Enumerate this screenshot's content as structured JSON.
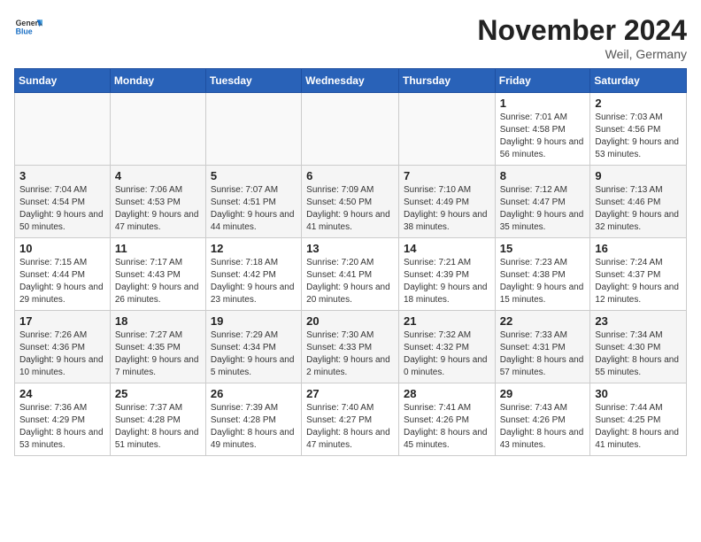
{
  "header": {
    "logo_line1": "General",
    "logo_line2": "Blue",
    "month_title": "November 2024",
    "location": "Weil, Germany"
  },
  "weekdays": [
    "Sunday",
    "Monday",
    "Tuesday",
    "Wednesday",
    "Thursday",
    "Friday",
    "Saturday"
  ],
  "weeks": [
    [
      {
        "day": "",
        "info": ""
      },
      {
        "day": "",
        "info": ""
      },
      {
        "day": "",
        "info": ""
      },
      {
        "day": "",
        "info": ""
      },
      {
        "day": "",
        "info": ""
      },
      {
        "day": "1",
        "info": "Sunrise: 7:01 AM\nSunset: 4:58 PM\nDaylight: 9 hours and 56 minutes."
      },
      {
        "day": "2",
        "info": "Sunrise: 7:03 AM\nSunset: 4:56 PM\nDaylight: 9 hours and 53 minutes."
      }
    ],
    [
      {
        "day": "3",
        "info": "Sunrise: 7:04 AM\nSunset: 4:54 PM\nDaylight: 9 hours and 50 minutes."
      },
      {
        "day": "4",
        "info": "Sunrise: 7:06 AM\nSunset: 4:53 PM\nDaylight: 9 hours and 47 minutes."
      },
      {
        "day": "5",
        "info": "Sunrise: 7:07 AM\nSunset: 4:51 PM\nDaylight: 9 hours and 44 minutes."
      },
      {
        "day": "6",
        "info": "Sunrise: 7:09 AM\nSunset: 4:50 PM\nDaylight: 9 hours and 41 minutes."
      },
      {
        "day": "7",
        "info": "Sunrise: 7:10 AM\nSunset: 4:49 PM\nDaylight: 9 hours and 38 minutes."
      },
      {
        "day": "8",
        "info": "Sunrise: 7:12 AM\nSunset: 4:47 PM\nDaylight: 9 hours and 35 minutes."
      },
      {
        "day": "9",
        "info": "Sunrise: 7:13 AM\nSunset: 4:46 PM\nDaylight: 9 hours and 32 minutes."
      }
    ],
    [
      {
        "day": "10",
        "info": "Sunrise: 7:15 AM\nSunset: 4:44 PM\nDaylight: 9 hours and 29 minutes."
      },
      {
        "day": "11",
        "info": "Sunrise: 7:17 AM\nSunset: 4:43 PM\nDaylight: 9 hours and 26 minutes."
      },
      {
        "day": "12",
        "info": "Sunrise: 7:18 AM\nSunset: 4:42 PM\nDaylight: 9 hours and 23 minutes."
      },
      {
        "day": "13",
        "info": "Sunrise: 7:20 AM\nSunset: 4:41 PM\nDaylight: 9 hours and 20 minutes."
      },
      {
        "day": "14",
        "info": "Sunrise: 7:21 AM\nSunset: 4:39 PM\nDaylight: 9 hours and 18 minutes."
      },
      {
        "day": "15",
        "info": "Sunrise: 7:23 AM\nSunset: 4:38 PM\nDaylight: 9 hours and 15 minutes."
      },
      {
        "day": "16",
        "info": "Sunrise: 7:24 AM\nSunset: 4:37 PM\nDaylight: 9 hours and 12 minutes."
      }
    ],
    [
      {
        "day": "17",
        "info": "Sunrise: 7:26 AM\nSunset: 4:36 PM\nDaylight: 9 hours and 10 minutes."
      },
      {
        "day": "18",
        "info": "Sunrise: 7:27 AM\nSunset: 4:35 PM\nDaylight: 9 hours and 7 minutes."
      },
      {
        "day": "19",
        "info": "Sunrise: 7:29 AM\nSunset: 4:34 PM\nDaylight: 9 hours and 5 minutes."
      },
      {
        "day": "20",
        "info": "Sunrise: 7:30 AM\nSunset: 4:33 PM\nDaylight: 9 hours and 2 minutes."
      },
      {
        "day": "21",
        "info": "Sunrise: 7:32 AM\nSunset: 4:32 PM\nDaylight: 9 hours and 0 minutes."
      },
      {
        "day": "22",
        "info": "Sunrise: 7:33 AM\nSunset: 4:31 PM\nDaylight: 8 hours and 57 minutes."
      },
      {
        "day": "23",
        "info": "Sunrise: 7:34 AM\nSunset: 4:30 PM\nDaylight: 8 hours and 55 minutes."
      }
    ],
    [
      {
        "day": "24",
        "info": "Sunrise: 7:36 AM\nSunset: 4:29 PM\nDaylight: 8 hours and 53 minutes."
      },
      {
        "day": "25",
        "info": "Sunrise: 7:37 AM\nSunset: 4:28 PM\nDaylight: 8 hours and 51 minutes."
      },
      {
        "day": "26",
        "info": "Sunrise: 7:39 AM\nSunset: 4:28 PM\nDaylight: 8 hours and 49 minutes."
      },
      {
        "day": "27",
        "info": "Sunrise: 7:40 AM\nSunset: 4:27 PM\nDaylight: 8 hours and 47 minutes."
      },
      {
        "day": "28",
        "info": "Sunrise: 7:41 AM\nSunset: 4:26 PM\nDaylight: 8 hours and 45 minutes."
      },
      {
        "day": "29",
        "info": "Sunrise: 7:43 AM\nSunset: 4:26 PM\nDaylight: 8 hours and 43 minutes."
      },
      {
        "day": "30",
        "info": "Sunrise: 7:44 AM\nSunset: 4:25 PM\nDaylight: 8 hours and 41 minutes."
      }
    ]
  ]
}
